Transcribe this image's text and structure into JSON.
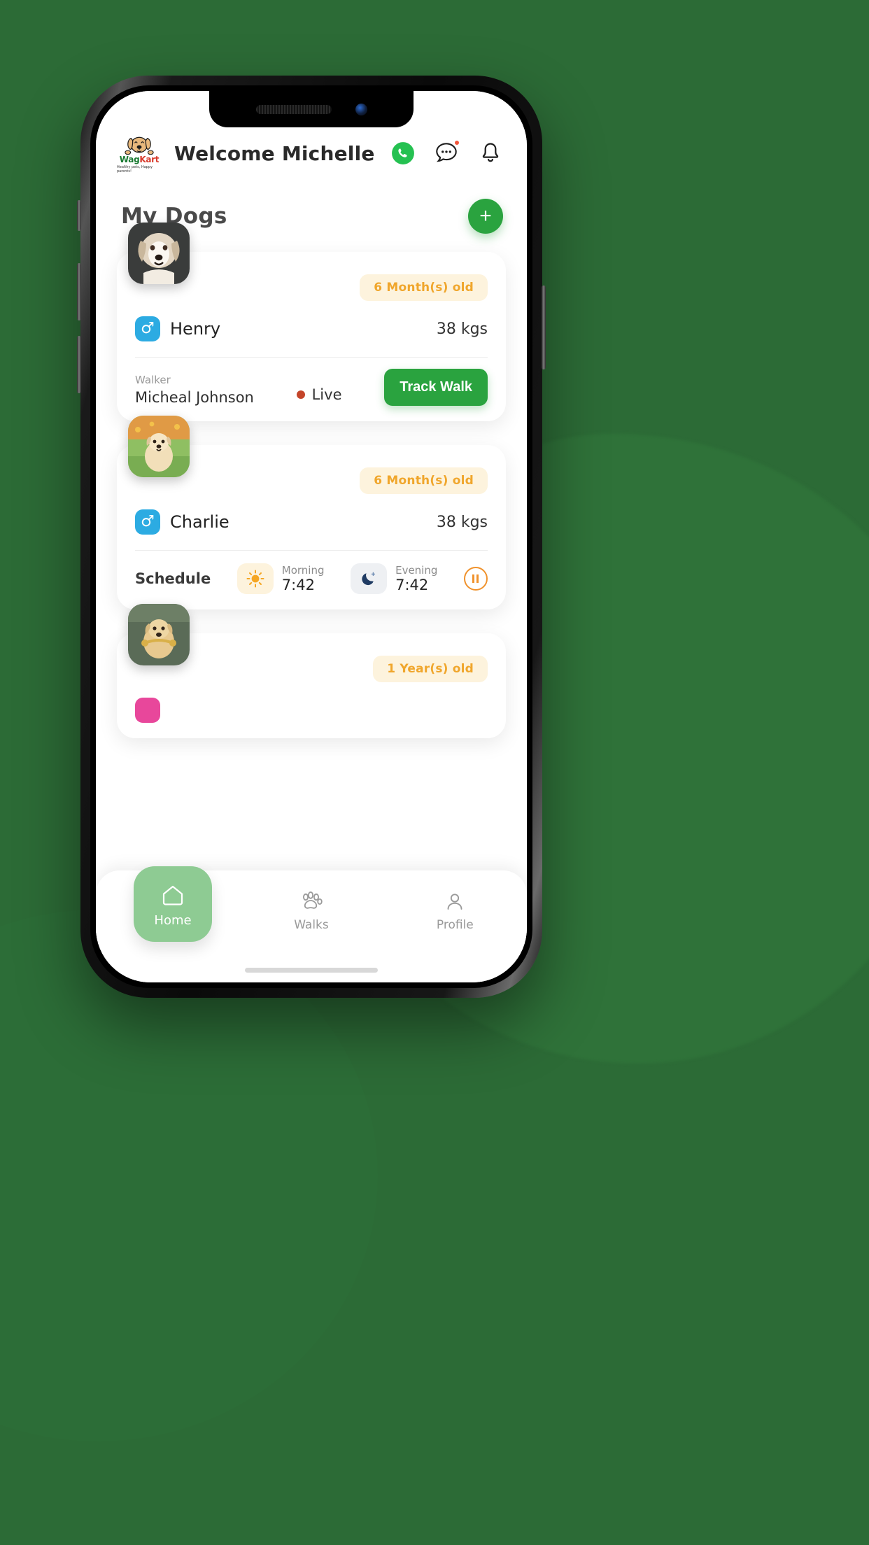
{
  "app": {
    "brand_name": "WagKart",
    "brand_tagline": "Healthy pets, Happy parents!",
    "accent_green": "#2aa33f",
    "accent_orange": "#f0a62c",
    "accent_blue": "#2cabe2",
    "background_green": "#2c6b36"
  },
  "header": {
    "title": "Welcome Michelle",
    "icons": [
      {
        "name": "whatsapp-icon",
        "label": "WhatsApp"
      },
      {
        "name": "chat-icon",
        "label": "Messages",
        "badge": true
      },
      {
        "name": "bell-icon",
        "label": "Notifications"
      }
    ]
  },
  "section": {
    "title": "My Dogs",
    "add_label": "+"
  },
  "dogs": [
    {
      "name": "Henry",
      "gender_symbol": "♂",
      "age": "6 Month(s) old",
      "weight": "38 kgs",
      "footer_type": "walker",
      "walker_label": "Walker",
      "walker_name": "Micheal Johnson",
      "live_text": "Live",
      "track_label": "Track Walk"
    },
    {
      "name": "Charlie",
      "gender_symbol": "♂",
      "age": "6 Month(s) old",
      "weight": "38 kgs",
      "footer_type": "schedule",
      "schedule_label": "Schedule",
      "morning_label": "Morning",
      "morning_time": "7:42",
      "evening_label": "Evening",
      "evening_time": "7:42"
    },
    {
      "name": "",
      "gender_symbol": "♂",
      "age": "1 Year(s) old",
      "weight": "",
      "footer_type": "none"
    }
  ],
  "bottom_nav": {
    "items": [
      {
        "label": "Home",
        "icon": "home-icon",
        "active": true
      },
      {
        "label": "Walks",
        "icon": "paw-icon",
        "active": false
      },
      {
        "label": "Profile",
        "icon": "person-icon",
        "active": false
      }
    ]
  }
}
